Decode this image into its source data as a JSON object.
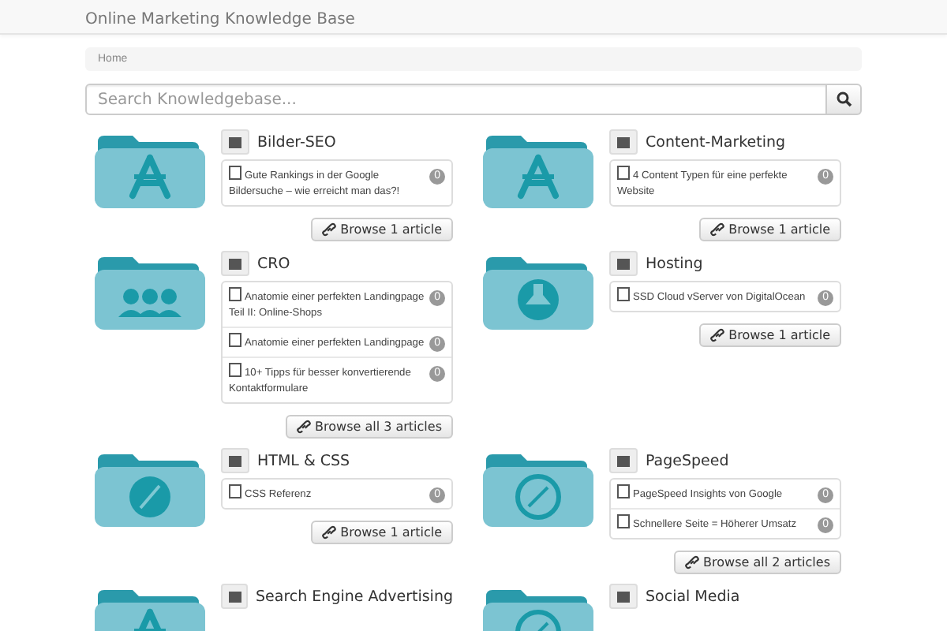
{
  "site_title": "Online Marketing Knowledge Base",
  "breadcrumb": [
    "Home"
  ],
  "search": {
    "placeholder": "Search Knowledgebase..."
  },
  "categories": [
    {
      "title": "Bilder-SEO",
      "kind": "app",
      "articles": [
        {
          "title": "Gute Rankings in der Google Bildersuche – wie erreicht man das?!",
          "count": "0"
        }
      ],
      "browse": "Browse 1 article"
    },
    {
      "title": "Content-Marketing",
      "kind": "app",
      "articles": [
        {
          "title": "4 Content Typen für eine perfekte Website",
          "count": "0"
        }
      ],
      "browse": "Browse 1 article"
    },
    {
      "title": "CRO",
      "kind": "people",
      "articles": [
        {
          "title": "Anatomie einer perfekten Landingpage Teil II: Online-Shops",
          "count": "0"
        },
        {
          "title": "Anatomie einer perfekten Landingpage",
          "count": "0"
        },
        {
          "title": "10+ Tipps für besser konvertierende Kontaktformulare",
          "count": "0"
        }
      ],
      "browse": "Browse all 3 articles"
    },
    {
      "title": "Hosting",
      "kind": "brush",
      "articles": [
        {
          "title": "SSD Cloud vServer von DigitalOcean",
          "count": "0"
        }
      ],
      "browse": "Browse 1 article"
    },
    {
      "title": "HTML & CSS",
      "kind": "hammer",
      "articles": [
        {
          "title": "CSS Referenz",
          "count": "0"
        }
      ],
      "browse": "Browse 1 article"
    },
    {
      "title": "PageSpeed",
      "kind": "compass",
      "articles": [
        {
          "title": "PageSpeed Insights von Google",
          "count": "0"
        },
        {
          "title": "Schnellere Seite = Höherer Umsatz",
          "count": "0"
        }
      ],
      "browse": "Browse all 2 articles"
    },
    {
      "title": "Search Engine Advertising",
      "kind": "app"
    },
    {
      "title": "Social Media",
      "kind": "compass"
    }
  ]
}
